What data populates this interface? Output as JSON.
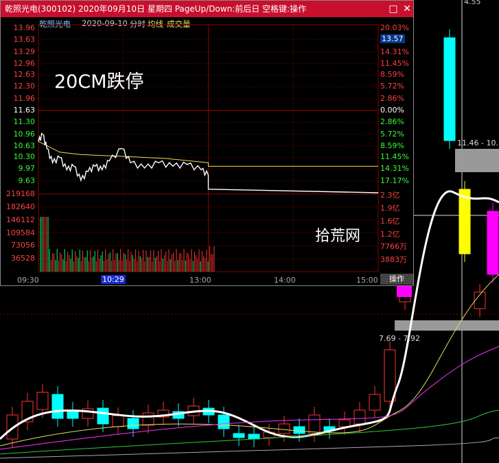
{
  "window": {
    "title": "乾照光电(300102)  2020年09月10日  星期四  PageUp/Down:前后日  空格键:操作",
    "minimize_label": "□",
    "close_label": "✕"
  },
  "legend": {
    "stock": "乾照光电",
    "date": "2020-09-10",
    "chart_type": "分时",
    "avg_label": "均线",
    "vol_label": "成交量"
  },
  "overlays": {
    "main_text": "20CM跌停",
    "watermark": "拾荒网"
  },
  "price_axis_left": [
    "13.96",
    "13.63",
    "13.29",
    "12.96",
    "12.63",
    "12.30",
    "11.96",
    "11.63",
    "11.30",
    "10.96",
    "10.63",
    "10.30",
    "9.97",
    "9.63"
  ],
  "price_axis_right": [
    "20.03%",
    "",
    "14.31%",
    "11.45%",
    "8.59%",
    "5.72%",
    "2.86%",
    "0.00%",
    "2.86%",
    "5.72%",
    "8.59%",
    "11.45%",
    "14.31%",
    "17.17%"
  ],
  "current_price_tag": "13.57",
  "volume_axis_left": [
    "219168",
    "182640",
    "146112",
    "109584",
    "73056",
    "36528"
  ],
  "volume_axis_right": [
    "2.3亿",
    "1.9亿",
    "1.6亿",
    "1.2亿",
    "7766万",
    "3883万"
  ],
  "time_axis": [
    "09:30",
    "13:00",
    "14:00",
    "15:00"
  ],
  "cursor_time": "10:29",
  "ops_button": "操作",
  "bg_labels": {
    "top_value": "4.55",
    "range_high": "11.46 - 10.",
    "range_low": "7.69 - 7.92"
  },
  "colors": {
    "up": "#ff3333",
    "down": "#00ffff",
    "flat": "#ffffff",
    "titlebar": "#c8102e",
    "grid": "#8b0000",
    "avg_line": "#e8e060"
  },
  "chart_data": {
    "type": "line",
    "title": "乾照光电 2020-09-10 分时",
    "prev_close": 11.63,
    "ylim": [
      9.3,
      13.96
    ],
    "x_sessions": [
      "09:30",
      "13:00",
      "14:00",
      "15:00"
    ],
    "price": [
      {
        "t": "09:30",
        "v": 10.75
      },
      {
        "t": "09:33",
        "v": 10.95
      },
      {
        "t": "09:36",
        "v": 10.55
      },
      {
        "t": "09:40",
        "v": 10.15
      },
      {
        "t": "09:45",
        "v": 10.3
      },
      {
        "t": "09:50",
        "v": 9.95
      },
      {
        "t": "09:55",
        "v": 10.05
      },
      {
        "t": "10:00",
        "v": 9.65
      },
      {
        "t": "10:05",
        "v": 9.9
      },
      {
        "t": "10:10",
        "v": 10.05
      },
      {
        "t": "10:15",
        "v": 9.95
      },
      {
        "t": "10:20",
        "v": 10.2
      },
      {
        "t": "10:29",
        "v": 10.55
      },
      {
        "t": "10:35",
        "v": 10.15
      },
      {
        "t": "10:45",
        "v": 10.0
      },
      {
        "t": "10:55",
        "v": 10.15
      },
      {
        "t": "11:05",
        "v": 10.05
      },
      {
        "t": "11:15",
        "v": 10.1
      },
      {
        "t": "11:25",
        "v": 9.95
      },
      {
        "t": "11:30",
        "v": 9.8
      },
      {
        "t": "13:00",
        "v": 9.4
      },
      {
        "t": "15:00",
        "v": 9.3
      }
    ],
    "avg_price": [
      {
        "t": "09:30",
        "v": 10.75
      },
      {
        "t": "09:45",
        "v": 10.45
      },
      {
        "t": "10:00",
        "v": 10.38
      },
      {
        "t": "10:30",
        "v": 10.33
      },
      {
        "t": "11:00",
        "v": 10.27
      },
      {
        "t": "11:30",
        "v": 10.15
      },
      {
        "t": "13:00",
        "v": 10.05
      },
      {
        "t": "15:00",
        "v": 10.05
      }
    ],
    "volume_ylim": [
      0,
      219168
    ]
  }
}
